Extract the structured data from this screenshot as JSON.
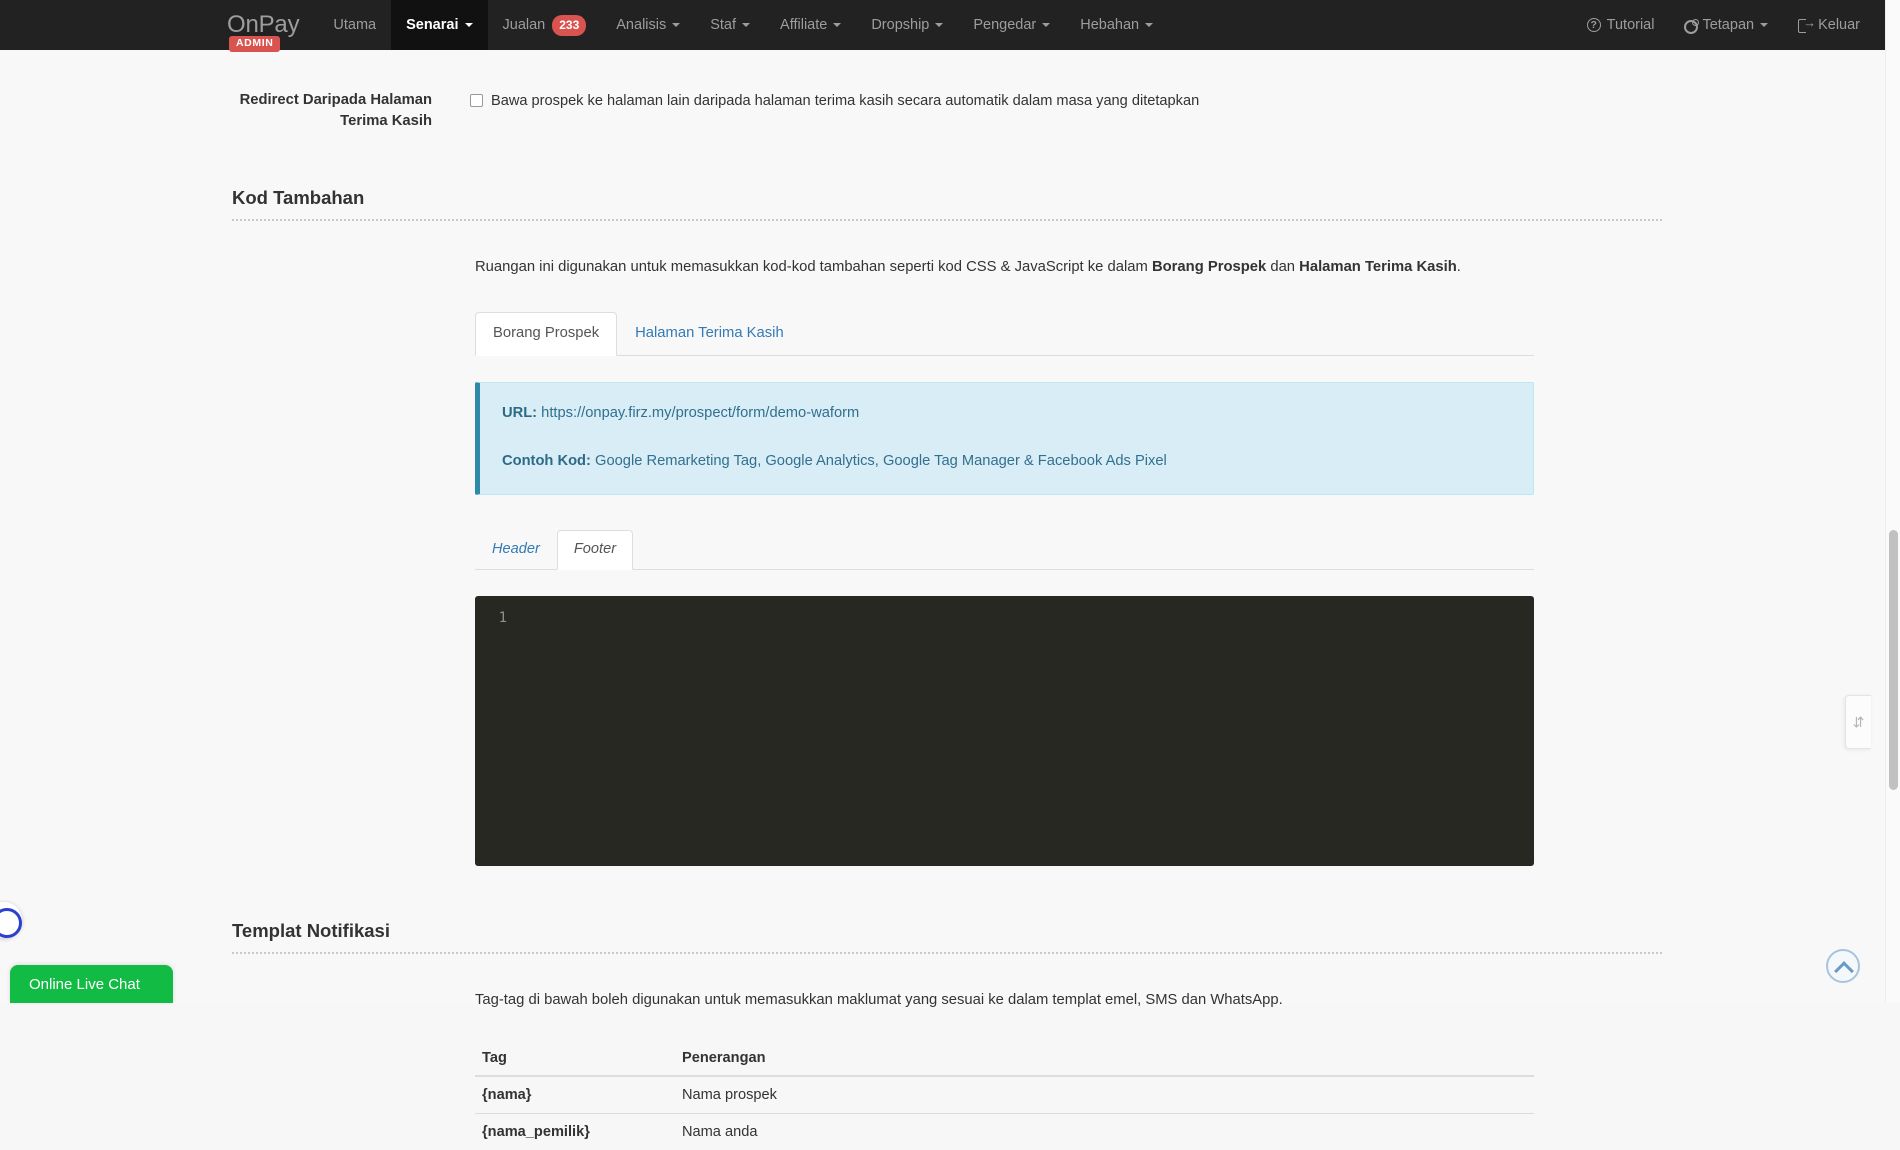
{
  "navbar": {
    "brand": "OnPay",
    "admin_badge": "ADMIN",
    "left_items": [
      {
        "label": "Utama",
        "caret": false,
        "active": false,
        "badge": null
      },
      {
        "label": "Senarai",
        "caret": true,
        "active": true,
        "badge": null
      },
      {
        "label": "Jualan",
        "caret": false,
        "active": false,
        "badge": "233"
      },
      {
        "label": "Analisis",
        "caret": true,
        "active": false,
        "badge": null
      },
      {
        "label": "Staf",
        "caret": true,
        "active": false,
        "badge": null
      },
      {
        "label": "Affiliate",
        "caret": true,
        "active": false,
        "badge": null
      },
      {
        "label": "Dropship",
        "caret": true,
        "active": false,
        "badge": null
      },
      {
        "label": "Pengedar",
        "caret": true,
        "active": false,
        "badge": null
      },
      {
        "label": "Hebahan",
        "caret": true,
        "active": false,
        "badge": null
      }
    ],
    "right_items": [
      {
        "label": "Tutorial",
        "icon": "question-circle-icon",
        "caret": false
      },
      {
        "label": "Tetapan",
        "icon": "gear-icon",
        "caret": true
      },
      {
        "label": "Keluar",
        "icon": "logout-icon",
        "caret": false
      }
    ]
  },
  "redirect_row": {
    "label": "Redirect Daripada Halaman Terima Kasih",
    "checkbox_label": "Bawa prospek ke halaman lain daripada halaman terima kasih secara automatik dalam masa yang ditetapkan",
    "checked": false
  },
  "kod_tambahan": {
    "title": "Kod Tambahan",
    "intro_prefix": "Ruangan ini digunakan untuk memasukkan kod-kod tambahan seperti kod CSS & JavaScript ke dalam ",
    "intro_bold_1": "Borang Prospek",
    "intro_middle": " dan ",
    "intro_bold_2": "Halaman Terima Kasih",
    "intro_suffix": ".",
    "tabs": [
      {
        "label": "Borang Prospek",
        "active": true
      },
      {
        "label": "Halaman Terima Kasih",
        "active": false
      }
    ],
    "well": {
      "url_label": "URL:",
      "url_value": "https://onpay.firz.my/prospect/form/demo-waform",
      "contoh_label": "Contoh Kod:",
      "contoh_value": "Google Remarketing Tag, Google Analytics, Google Tag Manager & Facebook Ads Pixel"
    },
    "inner_tabs": [
      {
        "label": "Header",
        "active": false
      },
      {
        "label": "Footer",
        "active": true
      }
    ],
    "editor": {
      "line_numbers": "1",
      "content": ""
    }
  },
  "templat_notifikasi": {
    "title": "Templat Notifikasi",
    "intro": "Tag-tag di bawah boleh digunakan untuk memasukkan maklumat yang sesuai ke dalam templat emel, SMS dan WhatsApp.",
    "columns": [
      "Tag",
      "Penerangan"
    ],
    "rows": [
      {
        "tag": "{nama}",
        "penerangan": "Nama prospek"
      },
      {
        "tag": "{nama_pemilik}",
        "penerangan": "Nama anda"
      }
    ]
  },
  "widgets": {
    "chat_label": "Online Live Chat",
    "chat_color": "#11bb44",
    "scroll_top_name": "chevron-up-icon",
    "side_tab_glyph": "⇵"
  }
}
